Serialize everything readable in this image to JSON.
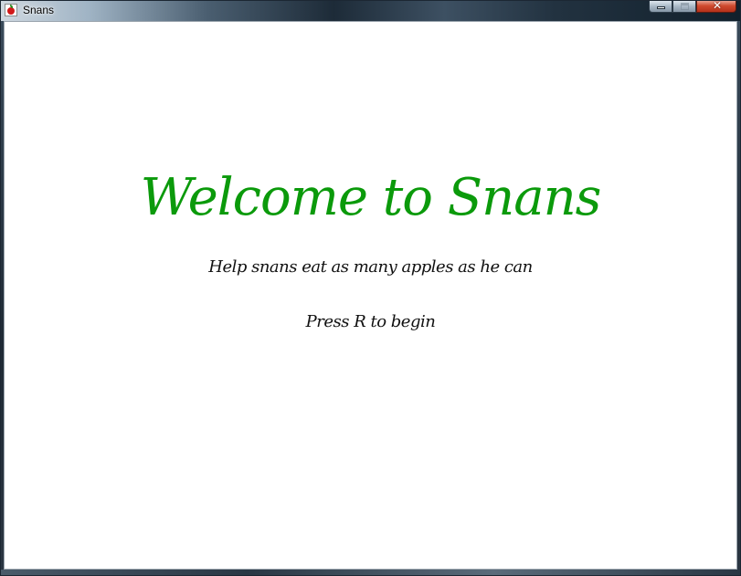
{
  "window": {
    "title": "Snans",
    "icon": "apple-icon",
    "controls": {
      "minimize_icon": "minimize-icon",
      "maximize_icon": "maximize-icon",
      "close_icon": "close-icon",
      "close_glyph": "✕"
    }
  },
  "game": {
    "welcome_text": "Welcome to Snans",
    "subtitle": "Help snans eat as many apples as he can",
    "prompt": "Press R to begin",
    "colors": {
      "welcome": "#0b9a0b",
      "text": "#111111",
      "background": "#ffffff"
    }
  }
}
